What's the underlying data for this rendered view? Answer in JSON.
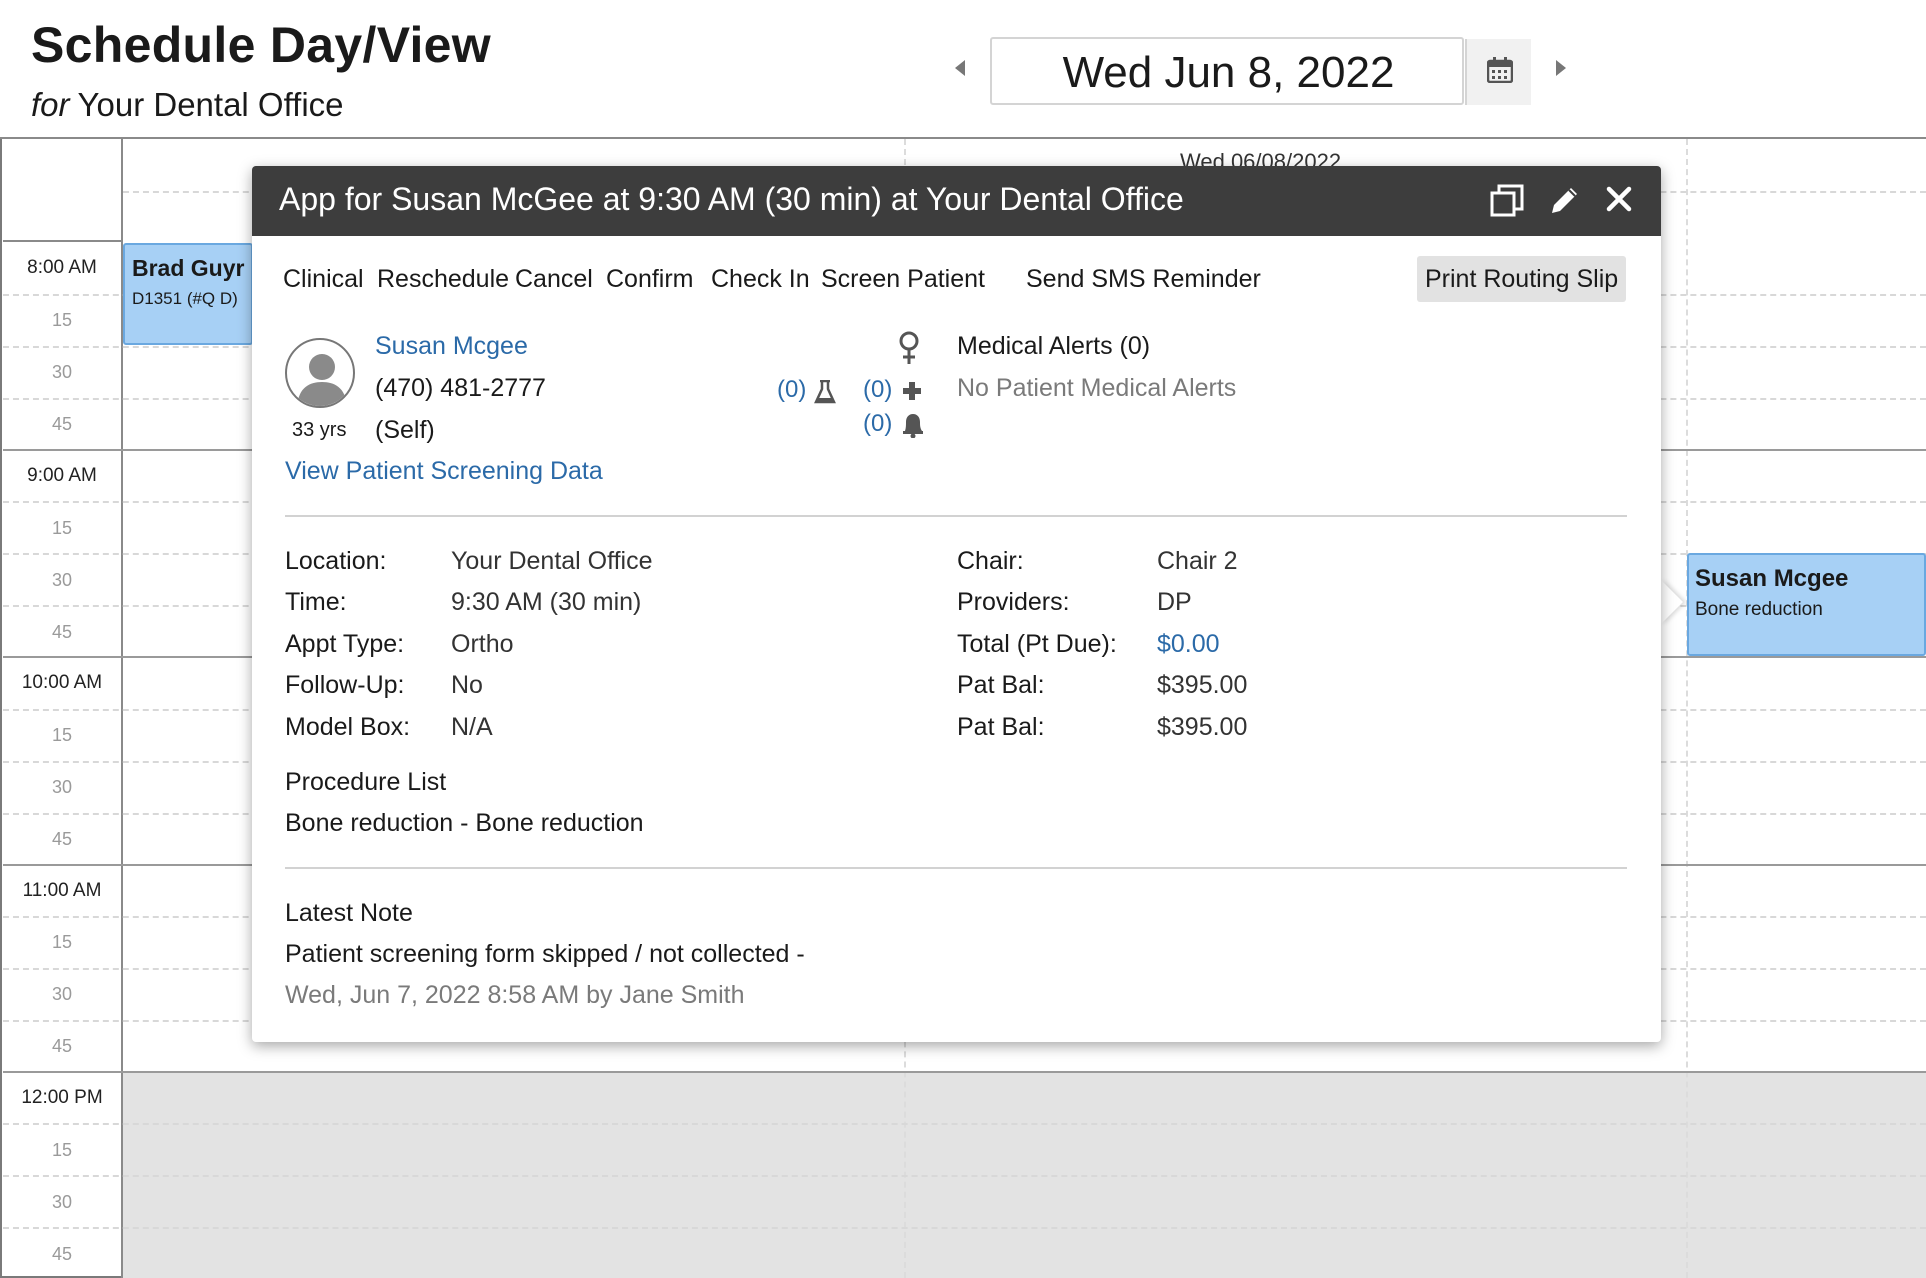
{
  "header": {
    "title": "Schedule Day/View",
    "subtitle_prefix": "for",
    "office": "Your Dental Office",
    "date": "Wed Jun 8, 2022"
  },
  "schedule": {
    "column_header": "Wed 06/08/2022",
    "hours": [
      {
        "label": "8:00 AM",
        "quarters": [
          "15",
          "30",
          "45"
        ]
      },
      {
        "label": "9:00 AM",
        "quarters": [
          "15",
          "30",
          "45"
        ]
      },
      {
        "label": "10:00 AM",
        "quarters": [
          "15",
          "30",
          "45"
        ]
      },
      {
        "label": "11:00 AM",
        "quarters": [
          "15",
          "30",
          "45"
        ]
      },
      {
        "label": "12:00 PM",
        "quarters": [
          "15",
          "30",
          "45"
        ]
      }
    ],
    "appointments": [
      {
        "name": "Brad Guyr",
        "detail": "D1351 (#Q D)"
      },
      {
        "name": "Susan Mcgee",
        "detail": "Bone reduction"
      }
    ]
  },
  "popup": {
    "title": "App for Susan McGee at 9:30 AM (30 min) at Your Dental Office",
    "actions": [
      "Clinical",
      "Reschedule",
      "Cancel",
      "Confirm",
      "Check In",
      "Screen Patient",
      "Send SMS Reminder",
      "Print Routing Slip"
    ],
    "patient": {
      "name": "Susan Mcgee",
      "phone": "(470) 481-2777",
      "relation": "(Self)",
      "age": "33 yrs",
      "screening_link": "View Patient Screening Data"
    },
    "counts": {
      "lab": "(0)",
      "medical": "(0)",
      "alerts": "(0)"
    },
    "medical_alerts": {
      "title": "Medical Alerts (0)",
      "none": "No Patient Medical Alerts"
    },
    "details_left": [
      {
        "label": "Location:",
        "value": "Your Dental Office"
      },
      {
        "label": "Time:",
        "value": "9:30 AM (30 min)"
      },
      {
        "label": "Appt Type:",
        "value": "Ortho"
      },
      {
        "label": "Follow-Up:",
        "value": "No"
      },
      {
        "label": "Model Box:",
        "value": "N/A"
      }
    ],
    "details_right": [
      {
        "label": "Chair:",
        "value": "Chair 2"
      },
      {
        "label": "Providers:",
        "value": "DP"
      },
      {
        "label": "Total (Pt Due):",
        "value": "$0.00"
      },
      {
        "label": "Pat Bal:",
        "value": "$395.00"
      },
      {
        "label": "Pat Bal:",
        "value": "$395.00"
      }
    ],
    "procedure": {
      "title": "Procedure List",
      "text": "Bone reduction - Bone reduction"
    },
    "note": {
      "title": "Latest Note",
      "text": "Patient screening form skipped / not collected -",
      "meta": "Wed, Jun 7, 2022 8:58 AM by Jane Smith"
    }
  },
  "colors": {
    "accent_link": "#2b6aa8",
    "appointment_bg": "#a7d0f5",
    "popup_header": "#3d3d3d"
  },
  "icons": [
    "calendar-icon",
    "copy-icon",
    "pencil-icon",
    "close-icon",
    "female-icon",
    "flask-icon",
    "plus-icon",
    "bell-icon",
    "person-icon"
  ]
}
